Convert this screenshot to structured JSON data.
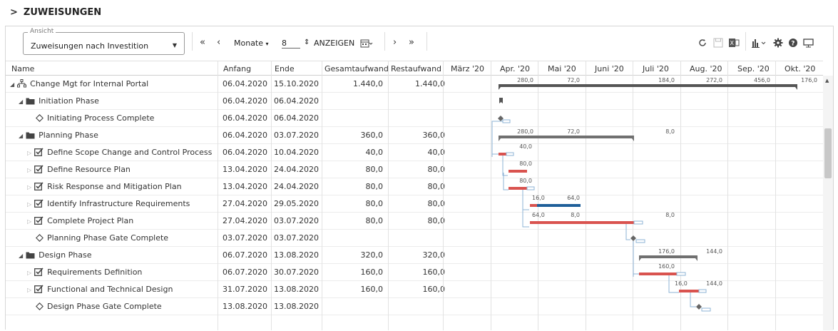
{
  "page": {
    "title": "ZUWEISUNGEN"
  },
  "toolbar": {
    "view_label": "Ansicht",
    "view_value": "Zuweisungen nach Investition",
    "unit_label": "Monate",
    "unit_count": "8",
    "show_label": "ANZEIGEN"
  },
  "columns": {
    "name": "Name",
    "start": "Anfang",
    "end": "Ende",
    "total": "Gesamtaufwand",
    "remaining": "Restaufwand"
  },
  "months": [
    "März '20",
    "Apr. '20",
    "Mai '20",
    "Juni '20",
    "Juli '20",
    "Aug. '20",
    "Sep. '20",
    "Okt. '20"
  ],
  "rows": [
    {
      "name": "Change Mgt for Internal Portal",
      "level": 0,
      "icon": "project-icon",
      "tri": "open",
      "start": "06.04.2020",
      "end": "15.10.2020",
      "total": "1.440,0",
      "remaining": "1.440,0"
    },
    {
      "name": "Initiation Phase",
      "level": 1,
      "icon": "phase-icon",
      "tri": "open",
      "start": "06.04.2020",
      "end": "06.04.2020",
      "total": "",
      "remaining": ""
    },
    {
      "name": "Initiating Process Complete",
      "level": 2,
      "icon": "milestone-icon",
      "tri": "none",
      "start": "06.04.2020",
      "end": "06.04.2020",
      "total": "",
      "remaining": ""
    },
    {
      "name": "Planning Phase",
      "level": 1,
      "icon": "phase-icon",
      "tri": "open",
      "start": "06.04.2020",
      "end": "03.07.2020",
      "total": "360,0",
      "remaining": "360,0"
    },
    {
      "name": "Define Scope Change and Control Process",
      "level": 2,
      "icon": "task-icon",
      "tri": "closed",
      "start": "06.04.2020",
      "end": "10.04.2020",
      "total": "40,0",
      "remaining": "40,0"
    },
    {
      "name": "Define Resource Plan",
      "level": 2,
      "icon": "task-icon",
      "tri": "closed",
      "start": "13.04.2020",
      "end": "24.04.2020",
      "total": "80,0",
      "remaining": "80,0"
    },
    {
      "name": "Risk Response and Mitigation Plan",
      "level": 2,
      "icon": "task-icon",
      "tri": "closed",
      "start": "13.04.2020",
      "end": "24.04.2020",
      "total": "80,0",
      "remaining": "80,0"
    },
    {
      "name": "Identify Infrastructure Requirements",
      "level": 2,
      "icon": "task-icon",
      "tri": "closed",
      "start": "27.04.2020",
      "end": "29.05.2020",
      "total": "80,0",
      "remaining": "80,0"
    },
    {
      "name": "Complete Project Plan",
      "level": 2,
      "icon": "task-icon",
      "tri": "closed",
      "start": "27.04.2020",
      "end": "03.07.2020",
      "total": "80,0",
      "remaining": "80,0"
    },
    {
      "name": "Planning Phase Gate Complete",
      "level": 2,
      "icon": "milestone-icon",
      "tri": "none",
      "start": "03.07.2020",
      "end": "03.07.2020",
      "total": "",
      "remaining": ""
    },
    {
      "name": "Design Phase",
      "level": 1,
      "icon": "phase-icon",
      "tri": "open",
      "start": "06.07.2020",
      "end": "13.08.2020",
      "total": "320,0",
      "remaining": "320,0"
    },
    {
      "name": "Requirements Definition",
      "level": 2,
      "icon": "task-icon",
      "tri": "closed",
      "start": "06.07.2020",
      "end": "30.07.2020",
      "total": "160,0",
      "remaining": "160,0"
    },
    {
      "name": "Functional and Technical Design",
      "level": 2,
      "icon": "task-icon",
      "tri": "closed",
      "start": "31.07.2020",
      "end": "13.08.2020",
      "total": "160,0",
      "remaining": "160,0"
    },
    {
      "name": "Design Phase Gate Complete",
      "level": 2,
      "icon": "milestone-icon",
      "tri": "none",
      "start": "13.08.2020",
      "end": "13.08.2020",
      "total": "",
      "remaining": ""
    }
  ],
  "gantt_labels": {
    "row0": [
      "280,0",
      "72,0",
      "184,0",
      "272,0",
      "456,0",
      "176,0"
    ],
    "row3": [
      "280,0",
      "72,0",
      "8,0"
    ],
    "row4": [
      "40,0"
    ],
    "row5": [
      "80,0"
    ],
    "row6": [
      "80,0"
    ],
    "row7": [
      "16,0",
      "64,0"
    ],
    "row8": [
      "64,0",
      "8,0",
      "8,0"
    ],
    "row10": [
      "176,0",
      "144,0"
    ],
    "row11": [
      "160,0"
    ],
    "row12": [
      "16,0",
      "144,0"
    ]
  },
  "colors": {
    "summary_bar": "#707070",
    "task_bar": "#d9534f",
    "task_bar_blue": "#1f5f99",
    "link": "#8db3d6"
  }
}
